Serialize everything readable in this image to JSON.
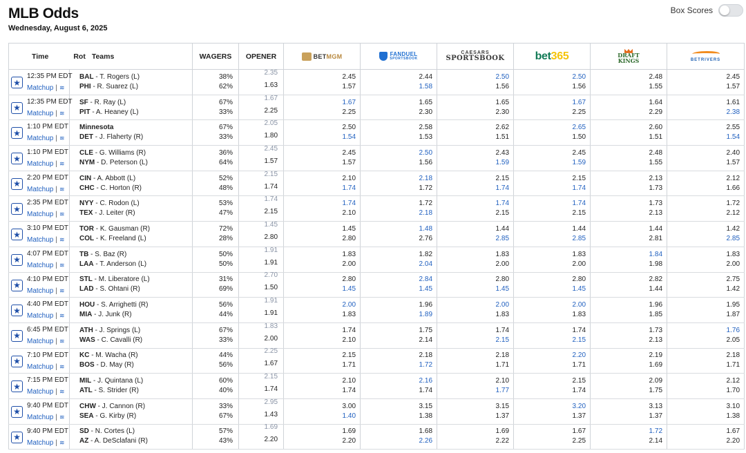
{
  "header": {
    "title": "MLB Odds",
    "date": "Wednesday, August 6, 2025",
    "box_scores_label": "Box Scores",
    "box_scores_on": false
  },
  "columns": {
    "time": "Time",
    "rot": "Rot",
    "teams": "Teams",
    "wagers": "WAGERS",
    "opener": "OPENER",
    "books": [
      {
        "id": "betmgm",
        "name": "BETMGM",
        "text_a": "BET",
        "text_b": "MGM"
      },
      {
        "id": "fanduel",
        "name": "FANDUEL SPORTSBOOK",
        "text_a": "FANDUEL",
        "text_b": "SPORTSBOOK"
      },
      {
        "id": "caesars",
        "name": "CAESARS SPORTSBOOK",
        "text_a": "CAESARS",
        "text_b": "SPORTSBOOK"
      },
      {
        "id": "bet365",
        "name": "bet365",
        "text_a": "bet",
        "text_b": "365"
      },
      {
        "id": "draftkings",
        "name": "DRAFT KINGS",
        "text_a": "DRAFT",
        "text_b": "KINGS"
      },
      {
        "id": "betrivers",
        "name": "BETRIVERS",
        "text_a": "BETRIVERS"
      }
    ]
  },
  "matchup_label": "Matchup",
  "games": [
    {
      "time": "12:35 PM EDT",
      "away": {
        "abbr": "BAL",
        "pitcher": " - T. Rogers (L)"
      },
      "home": {
        "abbr": "PHI",
        "pitcher": " - R. Suarez (L)"
      },
      "wagers": [
        "38%",
        "62%"
      ],
      "opener": [
        "2.35",
        "1.63"
      ],
      "odds": [
        [
          "2.45",
          "1.57"
        ],
        [
          "2.44",
          "1.58"
        ],
        [
          "2.50",
          "1.56"
        ],
        [
          "2.50",
          "1.56"
        ],
        [
          "2.48",
          "1.55"
        ],
        [
          "2.45",
          "1.57"
        ]
      ],
      "best": [
        [
          false,
          false
        ],
        [
          false,
          true
        ],
        [
          true,
          false
        ],
        [
          true,
          false
        ],
        [
          false,
          false
        ],
        [
          false,
          false
        ]
      ]
    },
    {
      "time": "12:35 PM EDT",
      "away": {
        "abbr": "SF",
        "pitcher": " - R. Ray (L)"
      },
      "home": {
        "abbr": "PIT",
        "pitcher": " - A. Heaney (L)"
      },
      "wagers": [
        "67%",
        "33%"
      ],
      "opener": [
        "1.67",
        "2.25"
      ],
      "odds": [
        [
          "1.67",
          "2.25"
        ],
        [
          "1.65",
          "2.30"
        ],
        [
          "1.65",
          "2.30"
        ],
        [
          "1.67",
          "2.25"
        ],
        [
          "1.64",
          "2.29"
        ],
        [
          "1.61",
          "2.38"
        ]
      ],
      "best": [
        [
          true,
          false
        ],
        [
          false,
          false
        ],
        [
          false,
          false
        ],
        [
          true,
          false
        ],
        [
          false,
          false
        ],
        [
          false,
          true
        ]
      ]
    },
    {
      "time": "1:10 PM EDT",
      "away": {
        "abbr": "Minnesota",
        "pitcher": ""
      },
      "home": {
        "abbr": "DET",
        "pitcher": " - J. Flaherty (R)"
      },
      "wagers": [
        "67%",
        "33%"
      ],
      "opener": [
        "2.05",
        "1.80"
      ],
      "odds": [
        [
          "2.50",
          "1.54"
        ],
        [
          "2.58",
          "1.53"
        ],
        [
          "2.62",
          "1.51"
        ],
        [
          "2.65",
          "1.50"
        ],
        [
          "2.60",
          "1.51"
        ],
        [
          "2.55",
          "1.54"
        ]
      ],
      "best": [
        [
          false,
          true
        ],
        [
          false,
          false
        ],
        [
          false,
          false
        ],
        [
          true,
          false
        ],
        [
          false,
          false
        ],
        [
          false,
          true
        ]
      ]
    },
    {
      "time": "1:10 PM EDT",
      "away": {
        "abbr": "CLE",
        "pitcher": " - G. Williams (R)"
      },
      "home": {
        "abbr": "NYM",
        "pitcher": " - D. Peterson (L)"
      },
      "wagers": [
        "36%",
        "64%"
      ],
      "opener": [
        "2.45",
        "1.57"
      ],
      "odds": [
        [
          "2.45",
          "1.57"
        ],
        [
          "2.50",
          "1.56"
        ],
        [
          "2.43",
          "1.59"
        ],
        [
          "2.45",
          "1.59"
        ],
        [
          "2.48",
          "1.55"
        ],
        [
          "2.40",
          "1.57"
        ]
      ],
      "best": [
        [
          false,
          false
        ],
        [
          true,
          false
        ],
        [
          false,
          true
        ],
        [
          false,
          true
        ],
        [
          false,
          false
        ],
        [
          false,
          false
        ]
      ]
    },
    {
      "time": "2:20 PM EDT",
      "away": {
        "abbr": "CIN",
        "pitcher": " - A. Abbott (L)"
      },
      "home": {
        "abbr": "CHC",
        "pitcher": " - C. Horton (R)"
      },
      "wagers": [
        "52%",
        "48%"
      ],
      "opener": [
        "2.15",
        "1.74"
      ],
      "odds": [
        [
          "2.10",
          "1.74"
        ],
        [
          "2.18",
          "1.72"
        ],
        [
          "2.15",
          "1.74"
        ],
        [
          "2.15",
          "1.74"
        ],
        [
          "2.13",
          "1.73"
        ],
        [
          "2.12",
          "1.66"
        ]
      ],
      "best": [
        [
          false,
          true
        ],
        [
          true,
          false
        ],
        [
          false,
          true
        ],
        [
          false,
          true
        ],
        [
          false,
          false
        ],
        [
          false,
          false
        ]
      ]
    },
    {
      "time": "2:35 PM EDT",
      "away": {
        "abbr": "NYY",
        "pitcher": " - C. Rodon (L)"
      },
      "home": {
        "abbr": "TEX",
        "pitcher": " - J. Leiter (R)"
      },
      "wagers": [
        "53%",
        "47%"
      ],
      "opener": [
        "1.74",
        "2.15"
      ],
      "odds": [
        [
          "1.74",
          "2.10"
        ],
        [
          "1.72",
          "2.18"
        ],
        [
          "1.74",
          "2.15"
        ],
        [
          "1.74",
          "2.15"
        ],
        [
          "1.73",
          "2.13"
        ],
        [
          "1.72",
          "2.12"
        ]
      ],
      "best": [
        [
          true,
          false
        ],
        [
          false,
          true
        ],
        [
          true,
          false
        ],
        [
          true,
          false
        ],
        [
          false,
          false
        ],
        [
          false,
          false
        ]
      ]
    },
    {
      "time": "3:10 PM EDT",
      "away": {
        "abbr": "TOR",
        "pitcher": " - K. Gausman (R)"
      },
      "home": {
        "abbr": "COL",
        "pitcher": " - K. Freeland (L)"
      },
      "wagers": [
        "72%",
        "28%"
      ],
      "opener": [
        "1.45",
        "2.80"
      ],
      "odds": [
        [
          "1.45",
          "2.80"
        ],
        [
          "1.48",
          "2.76"
        ],
        [
          "1.44",
          "2.85"
        ],
        [
          "1.44",
          "2.85"
        ],
        [
          "1.44",
          "2.81"
        ],
        [
          "1.42",
          "2.85"
        ]
      ],
      "best": [
        [
          false,
          false
        ],
        [
          true,
          false
        ],
        [
          false,
          true
        ],
        [
          false,
          true
        ],
        [
          false,
          false
        ],
        [
          false,
          true
        ]
      ]
    },
    {
      "time": "4:07 PM EDT",
      "away": {
        "abbr": "TB",
        "pitcher": " - S. Baz (R)"
      },
      "home": {
        "abbr": "LAA",
        "pitcher": " - T. Anderson (L)"
      },
      "wagers": [
        "50%",
        "50%"
      ],
      "opener": [
        "1.91",
        "1.91"
      ],
      "odds": [
        [
          "1.83",
          "2.00"
        ],
        [
          "1.82",
          "2.04"
        ],
        [
          "1.83",
          "2.00"
        ],
        [
          "1.83",
          "2.00"
        ],
        [
          "1.84",
          "1.98"
        ],
        [
          "1.83",
          "2.00"
        ]
      ],
      "best": [
        [
          false,
          false
        ],
        [
          false,
          true
        ],
        [
          false,
          false
        ],
        [
          false,
          false
        ],
        [
          true,
          false
        ],
        [
          false,
          false
        ]
      ]
    },
    {
      "time": "4:10 PM EDT",
      "away": {
        "abbr": "STL",
        "pitcher": " - M. Liberatore (L)"
      },
      "home": {
        "abbr": "LAD",
        "pitcher": " - S. Ohtani (R)"
      },
      "wagers": [
        "31%",
        "69%"
      ],
      "opener": [
        "2.70",
        "1.50"
      ],
      "odds": [
        [
          "2.80",
          "1.45"
        ],
        [
          "2.84",
          "1.45"
        ],
        [
          "2.80",
          "1.45"
        ],
        [
          "2.80",
          "1.45"
        ],
        [
          "2.82",
          "1.44"
        ],
        [
          "2.75",
          "1.42"
        ]
      ],
      "best": [
        [
          false,
          true
        ],
        [
          true,
          true
        ],
        [
          false,
          true
        ],
        [
          false,
          true
        ],
        [
          false,
          false
        ],
        [
          false,
          false
        ]
      ]
    },
    {
      "time": "4:40 PM EDT",
      "away": {
        "abbr": "HOU",
        "pitcher": " - S. Arrighetti (R)"
      },
      "home": {
        "abbr": "MIA",
        "pitcher": " - J. Junk (R)"
      },
      "wagers": [
        "56%",
        "44%"
      ],
      "opener": [
        "1.91",
        "1.91"
      ],
      "odds": [
        [
          "2.00",
          "1.83"
        ],
        [
          "1.96",
          "1.89"
        ],
        [
          "2.00",
          "1.83"
        ],
        [
          "2.00",
          "1.83"
        ],
        [
          "1.96",
          "1.85"
        ],
        [
          "1.95",
          "1.87"
        ]
      ],
      "best": [
        [
          true,
          false
        ],
        [
          false,
          true
        ],
        [
          true,
          false
        ],
        [
          true,
          false
        ],
        [
          false,
          false
        ],
        [
          false,
          false
        ]
      ]
    },
    {
      "time": "6:45 PM EDT",
      "away": {
        "abbr": "ATH",
        "pitcher": " - J. Springs (L)"
      },
      "home": {
        "abbr": "WAS",
        "pitcher": " - C. Cavalli (R)"
      },
      "wagers": [
        "67%",
        "33%"
      ],
      "opener": [
        "1.83",
        "2.00"
      ],
      "odds": [
        [
          "1.74",
          "2.10"
        ],
        [
          "1.75",
          "2.14"
        ],
        [
          "1.74",
          "2.15"
        ],
        [
          "1.74",
          "2.15"
        ],
        [
          "1.73",
          "2.13"
        ],
        [
          "1.76",
          "2.05"
        ]
      ],
      "best": [
        [
          false,
          false
        ],
        [
          false,
          false
        ],
        [
          false,
          true
        ],
        [
          false,
          true
        ],
        [
          false,
          false
        ],
        [
          true,
          false
        ]
      ]
    },
    {
      "time": "7:10 PM EDT",
      "away": {
        "abbr": "KC",
        "pitcher": " - M. Wacha (R)"
      },
      "home": {
        "abbr": "BOS",
        "pitcher": " - D. May (R)"
      },
      "wagers": [
        "44%",
        "56%"
      ],
      "opener": [
        "2.25",
        "1.67"
      ],
      "odds": [
        [
          "2.15",
          "1.71"
        ],
        [
          "2.18",
          "1.72"
        ],
        [
          "2.18",
          "1.71"
        ],
        [
          "2.20",
          "1.71"
        ],
        [
          "2.19",
          "1.69"
        ],
        [
          "2.18",
          "1.71"
        ]
      ],
      "best": [
        [
          false,
          false
        ],
        [
          false,
          true
        ],
        [
          false,
          false
        ],
        [
          true,
          false
        ],
        [
          false,
          false
        ],
        [
          false,
          false
        ]
      ]
    },
    {
      "time": "7:15 PM EDT",
      "away": {
        "abbr": "MIL",
        "pitcher": " - J. Quintana (L)"
      },
      "home": {
        "abbr": "ATL",
        "pitcher": " - S. Strider (R)"
      },
      "wagers": [
        "60%",
        "40%"
      ],
      "opener": [
        "2.15",
        "1.74"
      ],
      "odds": [
        [
          "2.10",
          "1.74"
        ],
        [
          "2.16",
          "1.74"
        ],
        [
          "2.10",
          "1.77"
        ],
        [
          "2.15",
          "1.74"
        ],
        [
          "2.09",
          "1.75"
        ],
        [
          "2.12",
          "1.70"
        ]
      ],
      "best": [
        [
          false,
          false
        ],
        [
          true,
          false
        ],
        [
          false,
          true
        ],
        [
          false,
          false
        ],
        [
          false,
          false
        ],
        [
          false,
          false
        ]
      ]
    },
    {
      "time": "9:40 PM EDT",
      "away": {
        "abbr": "CHW",
        "pitcher": " - J. Cannon (R)"
      },
      "home": {
        "abbr": "SEA",
        "pitcher": " - G. Kirby (R)"
      },
      "wagers": [
        "33%",
        "67%"
      ],
      "opener": [
        "2.95",
        "1.43"
      ],
      "odds": [
        [
          "3.00",
          "1.40"
        ],
        [
          "3.15",
          "1.38"
        ],
        [
          "3.15",
          "1.37"
        ],
        [
          "3.20",
          "1.37"
        ],
        [
          "3.13",
          "1.37"
        ],
        [
          "3.10",
          "1.38"
        ]
      ],
      "best": [
        [
          false,
          true
        ],
        [
          false,
          false
        ],
        [
          false,
          false
        ],
        [
          true,
          false
        ],
        [
          false,
          false
        ],
        [
          false,
          false
        ]
      ]
    },
    {
      "time": "9:40 PM EDT",
      "away": {
        "abbr": "SD",
        "pitcher": " - N. Cortes (L)"
      },
      "home": {
        "abbr": "AZ",
        "pitcher": " - A. DeSclafani (R)"
      },
      "wagers": [
        "57%",
        "43%"
      ],
      "opener": [
        "1.69",
        "2.20"
      ],
      "odds": [
        [
          "1.69",
          "2.20"
        ],
        [
          "1.68",
          "2.26"
        ],
        [
          "1.69",
          "2.22"
        ],
        [
          "1.67",
          "2.25"
        ],
        [
          "1.72",
          "2.14"
        ],
        [
          "1.67",
          "2.20"
        ]
      ],
      "best": [
        [
          false,
          false
        ],
        [
          false,
          true
        ],
        [
          false,
          false
        ],
        [
          false,
          false
        ],
        [
          true,
          false
        ],
        [
          false,
          false
        ]
      ]
    }
  ],
  "colors": {
    "best_odds": "#1f5fbf",
    "opener": "#8a94a6",
    "star": "#1f4fa8"
  }
}
